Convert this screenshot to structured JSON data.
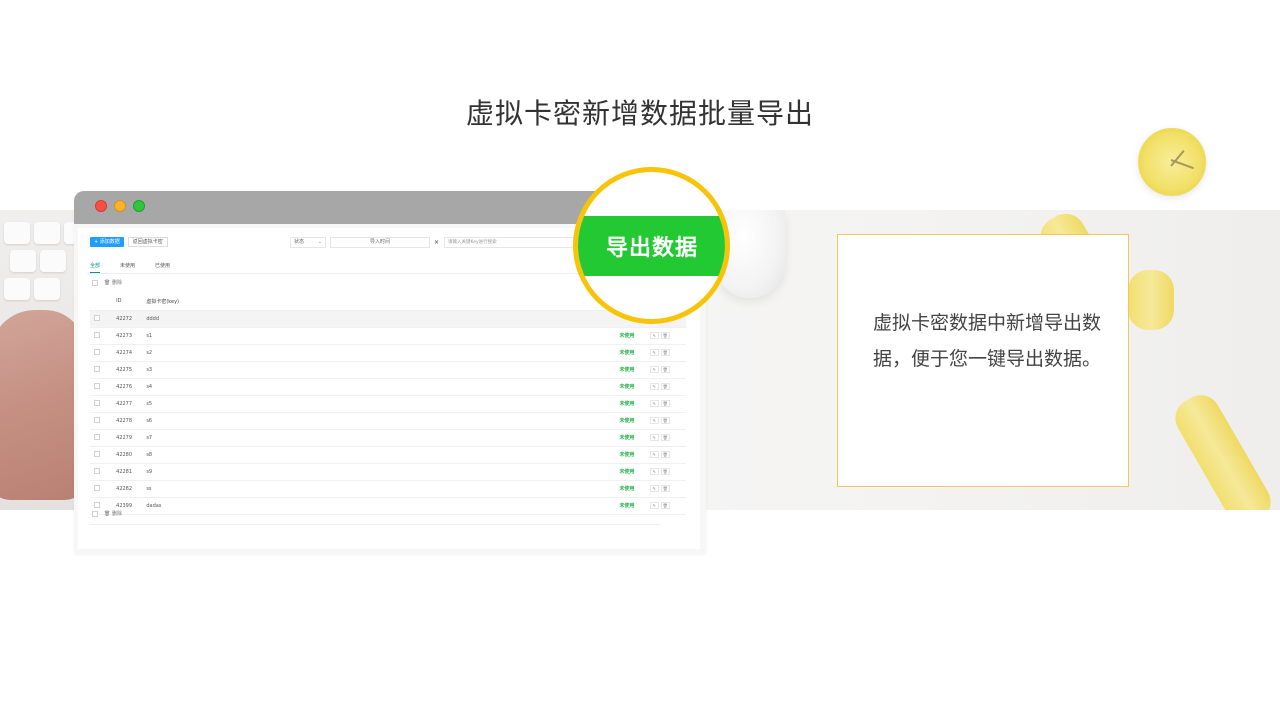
{
  "page_title": "虚拟卡密新增数据批量导出",
  "app": {
    "toolbar": {
      "add_label": "+ 添加数据",
      "back_label": "返回虚拟卡密"
    },
    "filters": {
      "status_label": "状态",
      "status_arrow": "⌄",
      "date_label": "导入时间",
      "clear_label": "×",
      "search_placeholder": "请输入关键Key进行搜索"
    },
    "tabs": [
      "全部",
      "未使用",
      "已使用"
    ],
    "bulk_delete_label": "删除",
    "table": {
      "headers": [
        "ID",
        "虚拟卡密(key)"
      ],
      "rows": [
        {
          "id": "42272",
          "key": "dddd",
          "status": "",
          "highlight": true
        },
        {
          "id": "42273",
          "key": "s1",
          "status": "未使用"
        },
        {
          "id": "42274",
          "key": "s2",
          "status": "未使用"
        },
        {
          "id": "42275",
          "key": "s3",
          "status": "未使用"
        },
        {
          "id": "42276",
          "key": "s4",
          "status": "未使用"
        },
        {
          "id": "42277",
          "key": "s5",
          "status": "未使用"
        },
        {
          "id": "42278",
          "key": "s6",
          "status": "未使用"
        },
        {
          "id": "42279",
          "key": "s7",
          "status": "未使用"
        },
        {
          "id": "42280",
          "key": "s8",
          "status": "未使用"
        },
        {
          "id": "42281",
          "key": "s9",
          "status": "未使用"
        },
        {
          "id": "42282",
          "key": "ss",
          "status": "未使用"
        },
        {
          "id": "42399",
          "key": "dadas",
          "status": "未使用"
        }
      ],
      "edit_icon": "✎",
      "delete_icon": "🗑"
    }
  },
  "zoom": {
    "label": "导出数据",
    "accent": "#22c932",
    "ring": "#f7c40a"
  },
  "description": "虚拟卡密数据中新增导出数据，便于您一键导出数据。"
}
